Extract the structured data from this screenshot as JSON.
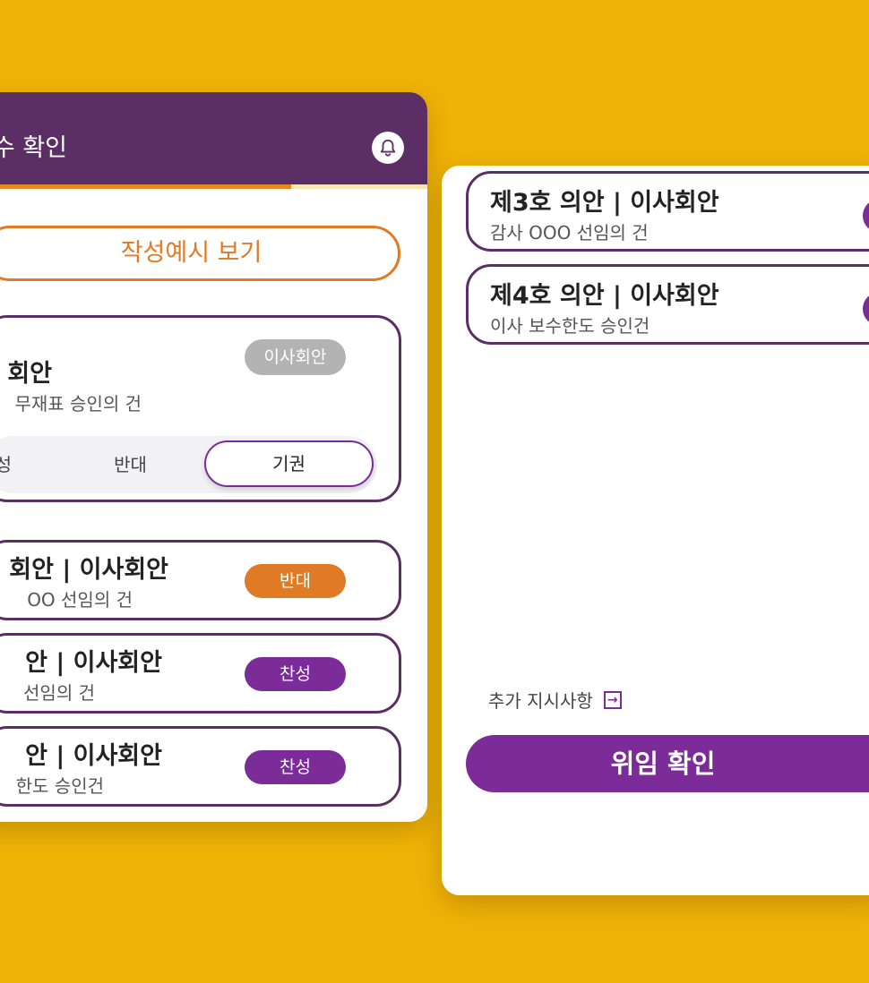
{
  "left_card": {
    "header_title": "수 확인",
    "example_button": "작성예시 보기",
    "expanded_agenda": {
      "title": "회안",
      "subtitle": "무재표 승인의 건",
      "tag": "이사회안",
      "options": {
        "approve": "성",
        "oppose": "반대",
        "abstain": "기권"
      },
      "selected": "기권"
    },
    "agenda_items": [
      {
        "title": "회안 | 이사회안",
        "subtitle": "OO 선임의 건",
        "vote": "반대"
      },
      {
        "title": "안 | 이사회안",
        "subtitle": "선임의 건",
        "vote": "찬성"
      },
      {
        "title": "안 | 이사회안",
        "subtitle": "한도 승인건",
        "vote": "찬성"
      }
    ]
  },
  "right_card": {
    "agenda_items": [
      {
        "title": "제3호 의안 | 이사회안",
        "subtitle": "감사 OOO 선임의 건"
      },
      {
        "title": "제4호 의안 | 이사회안",
        "subtitle": "이사 보수한도 승인건"
      }
    ],
    "extra_instructions": "추가 지시사항",
    "confirm_button": "위임 확인"
  },
  "colors": {
    "background": "#EFB206",
    "header": "#5B2E66",
    "accent_orange": "#E07A24",
    "accent_purple": "#7B2C98",
    "tag_gray": "#B3B3B3"
  },
  "icons": {
    "bell": "bell-icon",
    "extra": "arrow-into-box-icon"
  }
}
